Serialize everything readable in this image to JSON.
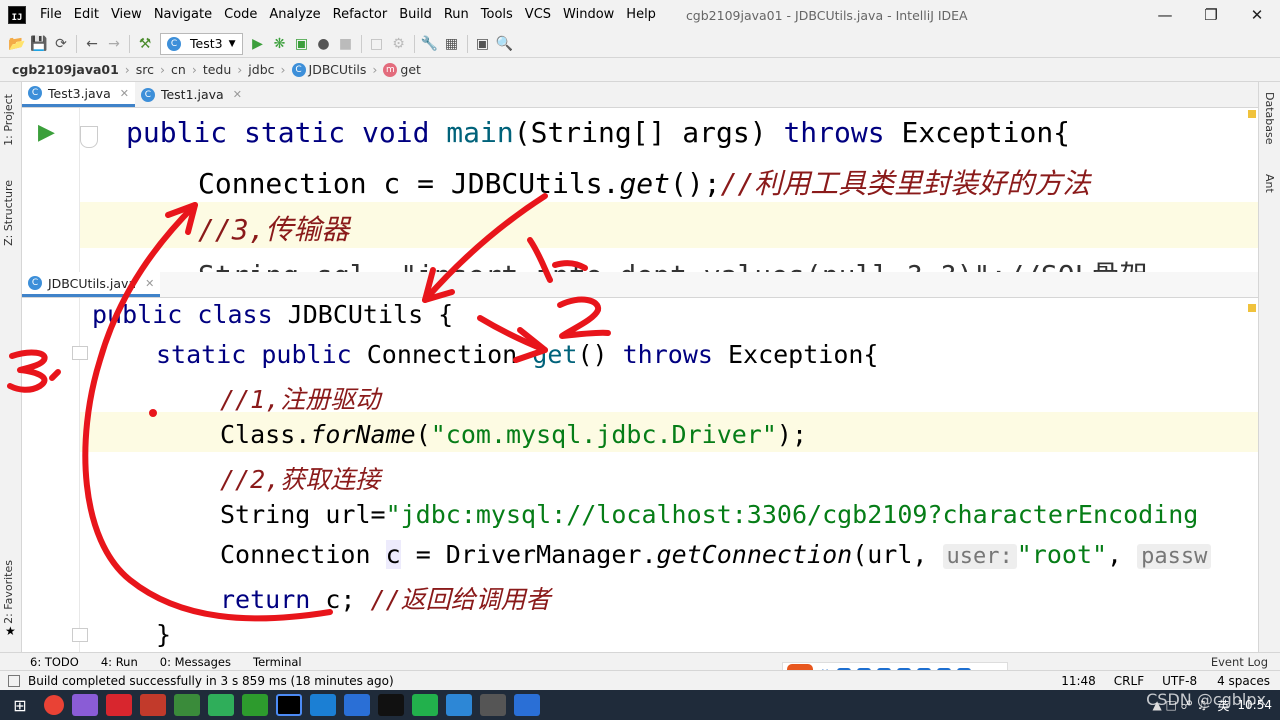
{
  "menu": [
    "File",
    "Edit",
    "View",
    "Navigate",
    "Code",
    "Analyze",
    "Refactor",
    "Build",
    "Run",
    "Tools",
    "VCS",
    "Window",
    "Help"
  ],
  "window_title": "cgb2109java01 - JDBCUtils.java - IntelliJ IDEA",
  "run_config": "Test3",
  "breadcrumb": {
    "project": "cgb2109java01",
    "src": "src",
    "p1": "cn",
    "p2": "tedu",
    "p3": "jdbc",
    "cls": "JDBCUtils",
    "method": "get"
  },
  "left_tools": {
    "project": "1: Project",
    "structure": "Z: Structure",
    "favorites": "2: Favorites"
  },
  "right_tools": {
    "database": "Database",
    "ant": "Ant"
  },
  "top_tabs": [
    "Test3.java",
    "Test1.java"
  ],
  "bottom_tab": "JDBCUtils.java",
  "top_code": {
    "l1": {
      "kw": "public static void ",
      "fn": "main",
      "rest": "(String[] args) ",
      "kw2": "throws ",
      "tail": "Exception{"
    },
    "l2": {
      "a": "Connection c = JDBCUtils.",
      "m": "get",
      "b": "();",
      "c": "//利用工具类里封装好的方法"
    },
    "l3": {
      "c": "//3,传输器"
    },
    "l4": {
      "a": "String sql =\"insert into dept values(null,?,?)\";//SQL骨架"
    }
  },
  "bottom_code": {
    "l1": {
      "kw": "public class ",
      "rest": "JDBCUtils {"
    },
    "l2": {
      "kw": "static public ",
      "a": "Connection ",
      "fn": "get",
      "b": "() ",
      "kw2": "throws ",
      "c": "Exception{"
    },
    "l3": {
      "c": "//1,注册驱动"
    },
    "l4": {
      "a": "Class.",
      "m": "forName",
      "b": "(",
      "s": "\"com.mysql.jdbc.Driver\"",
      "c": ");"
    },
    "l5": {
      "c": "//2,获取连接"
    },
    "l6": {
      "a": "String url=",
      "s": "\"jdbc:mysql://localhost:3306/cgb2109?characterEncoding"
    },
    "l7": {
      "a": "Connection ",
      "v": "c",
      "b": " = DriverManager.",
      "m": "getConnection",
      "c": "(url, ",
      "h1": "user:",
      "s": "\"root\"",
      ",": ", ",
      "h2": "passw"
    },
    "l8": {
      "kw": "return ",
      "a": "c; ",
      "c": "//返回给调用者"
    },
    "l9": {
      "a": "}"
    }
  },
  "bottom_tools": [
    "6: TODO",
    "4: Run",
    "0: Messages",
    "Terminal"
  ],
  "event_log": "Event Log",
  "status": {
    "msg": "Build completed successfully in 3 s 859 ms (18 minutes ago)",
    "pos": "11:48",
    "sep": "CRLF",
    "enc": "UTF-8",
    "indent": "4 spaces"
  },
  "taskbar": {
    "time": "10:54",
    "ime": "英",
    "watermark": "CSDN @cgblpx"
  },
  "annotations": {
    "n1": "1.",
    "n2": "2.",
    "n3": "3."
  }
}
